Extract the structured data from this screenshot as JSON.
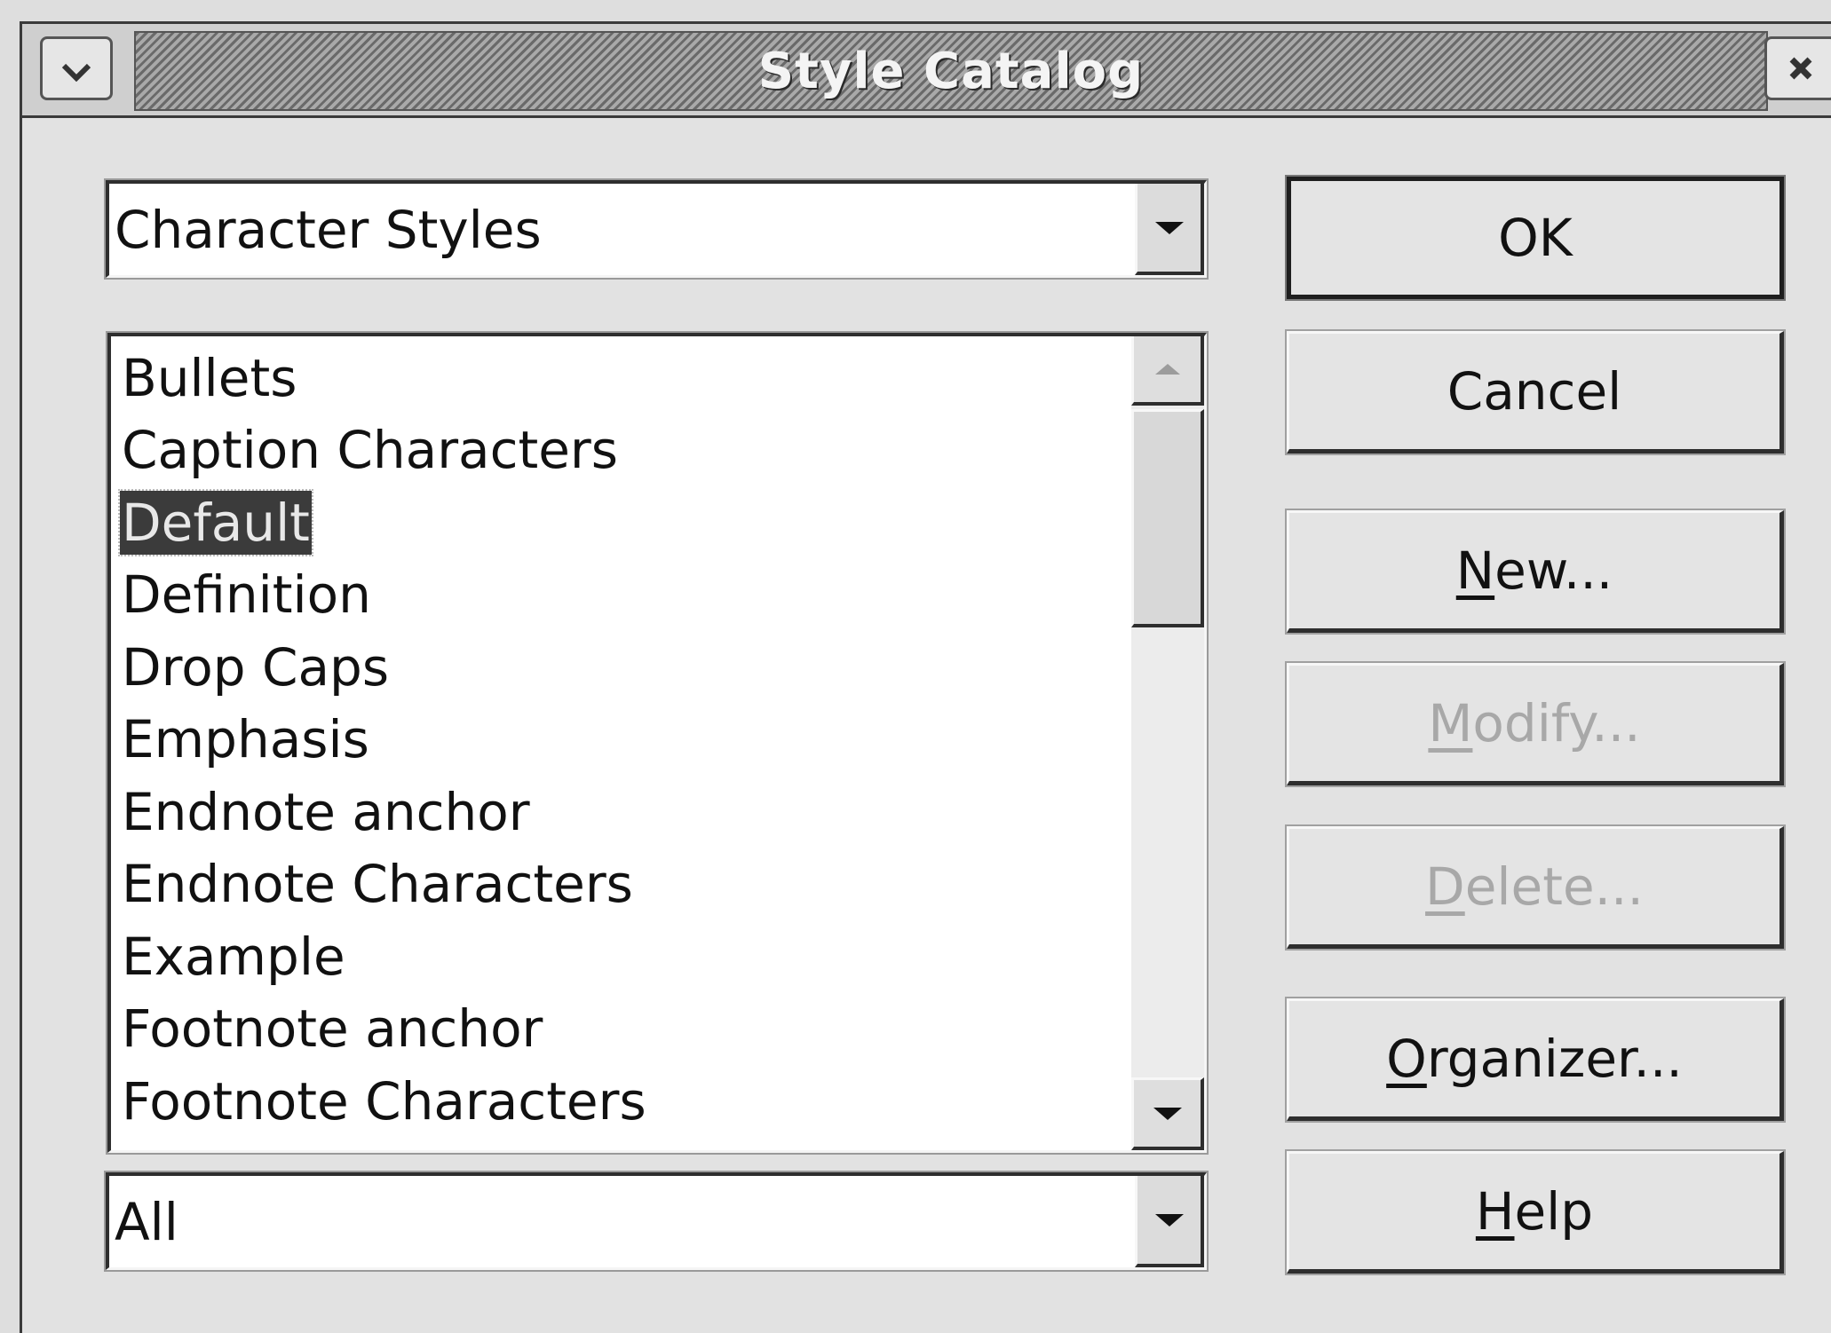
{
  "window": {
    "title": "Style Catalog",
    "menu_icon": "chevron-down-icon",
    "close_icon": "close-icon"
  },
  "category_combo": {
    "value": "Character Styles"
  },
  "styles_list": {
    "items": [
      "Bullets",
      "Caption Characters",
      "Default",
      "Definition",
      "Drop Caps",
      "Emphasis",
      "Endnote anchor",
      "Endnote Characters",
      "Example",
      "Footnote anchor",
      "Footnote Characters"
    ],
    "selected": "Default"
  },
  "filter_combo": {
    "value": "All"
  },
  "buttons": {
    "ok": {
      "label": "OK"
    },
    "cancel": {
      "label": "Cancel"
    },
    "new": {
      "mnemonic": "N",
      "rest": "ew..."
    },
    "modify": {
      "mnemonic": "M",
      "rest": "odify..."
    },
    "delete": {
      "mnemonic": "D",
      "rest": "elete..."
    },
    "organizer": {
      "mnemonic": "O",
      "rest": "rganizer..."
    },
    "help": {
      "mnemonic": "H",
      "rest": "elp"
    }
  }
}
